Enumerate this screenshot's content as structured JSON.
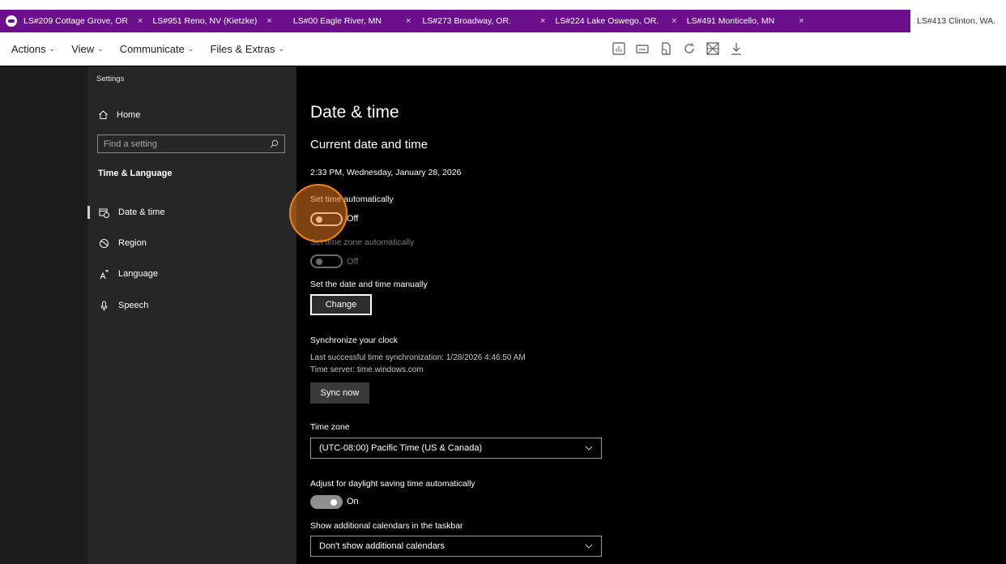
{
  "tabs": [
    {
      "label": "LS#209 Cottage Grove, OR",
      "closable": true
    },
    {
      "label": "LS#951 Reno, NV (Kietzke)",
      "closable": true
    },
    {
      "label": "LS#00 Eagle River, MN",
      "closable": true
    },
    {
      "label": "LS#273 Broadway, OR.",
      "closable": true
    },
    {
      "label": "LS#224 Lake Oswego, OR.",
      "closable": true
    },
    {
      "label": "LS#491 Monticello, MN",
      "closable": true
    },
    {
      "label": "LS#413 Clinton, WA.",
      "closable": false,
      "active": true
    }
  ],
  "close_glyph": "×",
  "menu": [
    {
      "label": "Actions"
    },
    {
      "label": "View"
    },
    {
      "label": "Communicate"
    },
    {
      "label": "Files & Extras"
    }
  ],
  "toolbar_icons": [
    "chart-icon",
    "keyboard-icon",
    "file-transfer-icon",
    "restart-icon",
    "screen-off-icon",
    "download-icon"
  ],
  "nav": {
    "caption": "Settings",
    "home": "Home",
    "search_placeholder": "Find a setting",
    "section": "Time & Language",
    "items": [
      {
        "label": "Date & time",
        "icon": "calendar-clock-icon",
        "selected": true
      },
      {
        "label": "Region",
        "icon": "globe-icon",
        "selected": false
      },
      {
        "label": "Language",
        "icon": "language-icon",
        "selected": false
      },
      {
        "label": "Speech",
        "icon": "microphone-icon",
        "selected": false
      }
    ]
  },
  "content": {
    "title": "Date & time",
    "subtitle": "Current date and time",
    "current_datetime": "2:33 PM, Wednesday, January 28, 2026",
    "set_time_auto": {
      "label": "Set time automatically",
      "state": "Off"
    },
    "set_zone_auto": {
      "label": "Set time zone automatically",
      "state": "Off"
    },
    "manual": {
      "label": "Set the date and time manually",
      "button": "Change"
    },
    "sync": {
      "heading": "Synchronize your clock",
      "last_sync": "Last successful time synchronization: 1/28/2026 4:46:50 AM",
      "server": "Time server: time.windows.com",
      "button": "Sync now"
    },
    "timezone": {
      "label": "Time zone",
      "value": "(UTC-08:00) Pacific Time (US & Canada)"
    },
    "dst": {
      "label": "Adjust for daylight saving time automatically",
      "state": "On"
    },
    "calendars": {
      "label": "Show additional calendars in the taskbar",
      "value": "Don't show additional calendars"
    }
  },
  "colors": {
    "tabbar": "#6b0f8c",
    "highlight": "#f0821e"
  }
}
